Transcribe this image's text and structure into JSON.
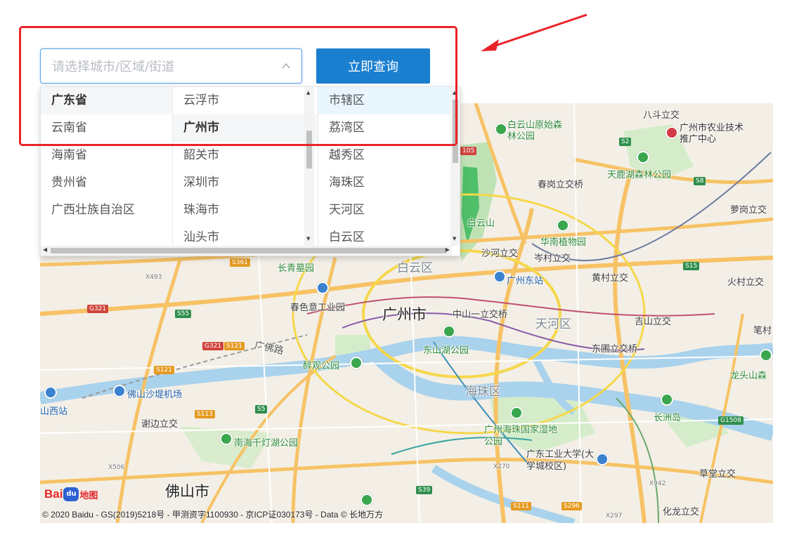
{
  "search": {
    "placeholder": "请选择城市/区域/街道",
    "value": "",
    "button_label": "立即查询"
  },
  "cascade": {
    "provinces": [
      "广东省",
      "云南省",
      "海南省",
      "贵州省",
      "广西壮族自治区"
    ],
    "selected_province": "广东省",
    "cities": [
      "云浮市",
      "广州市",
      "韶关市",
      "深圳市",
      "珠海市",
      "汕头市"
    ],
    "selected_city": "广州市",
    "districts": [
      "市辖区",
      "荔湾区",
      "越秀区",
      "海珠区",
      "天河区",
      "白云区"
    ],
    "hovered_district": "市辖区"
  },
  "map": {
    "labels": {
      "guangzhou": "广州市",
      "foshan": "佛山市",
      "tianhe": "天河区",
      "haizhu": "海珠区",
      "baiyun": "白云区",
      "baiyunshan_park": "白云山原始森林公园",
      "nongye_center": "广州市农业技术推广中心",
      "tianluhu": "天鹿湖森林公园",
      "chungang": "春岗立交桥",
      "baiyunshan": "白云山",
      "huanan_garden": "华南植物园",
      "shahe": "沙河立交",
      "cuncun": "岑村立交",
      "huangcun": "黄村立交",
      "huocun": "火村立交",
      "luogang": "萝岗立交",
      "bagan": "八斗立交",
      "changqing": "长青墓园",
      "guangzhou_east": "广州东站",
      "chunseyi": "春色意工业园",
      "zhongshan": "中山一立交桥",
      "jishan": "吉山立交",
      "longcun": "笔村",
      "dongshanhu": "东山湖公园",
      "dongpu": "东圃立交桥",
      "guangfo": "广佛路",
      "zuiguan": "醉观公园",
      "longtoushan": "龙头山森",
      "foshan_airport": "佛山沙堤机场",
      "shanxi_station": "山西站",
      "xiechi": "谢边立交",
      "nanhai_lake": "南海千灯湖公园",
      "haizhu_wetland": "广州海珠国家湿地公园",
      "changzhou": "长洲岛",
      "gdut": "广东工业大学(大学城校区)",
      "caotang": "草堂立交",
      "hualong": "化龙立交",
      "x493": "X493",
      "x506": "X506",
      "x270": "X270",
      "x942": "X942",
      "x297": "X297"
    },
    "badges": {
      "s361": "S361",
      "g321a": "G321",
      "s55": "S55",
      "g321b": "G321",
      "s121a": "S121",
      "s121b": "S121",
      "s113": "S113",
      "s5": "S5",
      "s39": "S39",
      "s111": "S111",
      "s296": "S296",
      "s15": "S15",
      "s8": "S8",
      "s2": "S2",
      "g1508": "G1508",
      "r105": "105"
    },
    "logo_text": "Bai",
    "logo_paw": "du",
    "logo_ditu": "地图",
    "copyright": "© 2020 Baidu - GS(2019)5218号 - 甲测资字1100930 - 京ICP证030173号 - Data © 长地万方"
  },
  "colors": {
    "accent_blue": "#1b7fd0",
    "highlight_red": "#e8232a",
    "hover_bg": "#e9f6fd"
  }
}
